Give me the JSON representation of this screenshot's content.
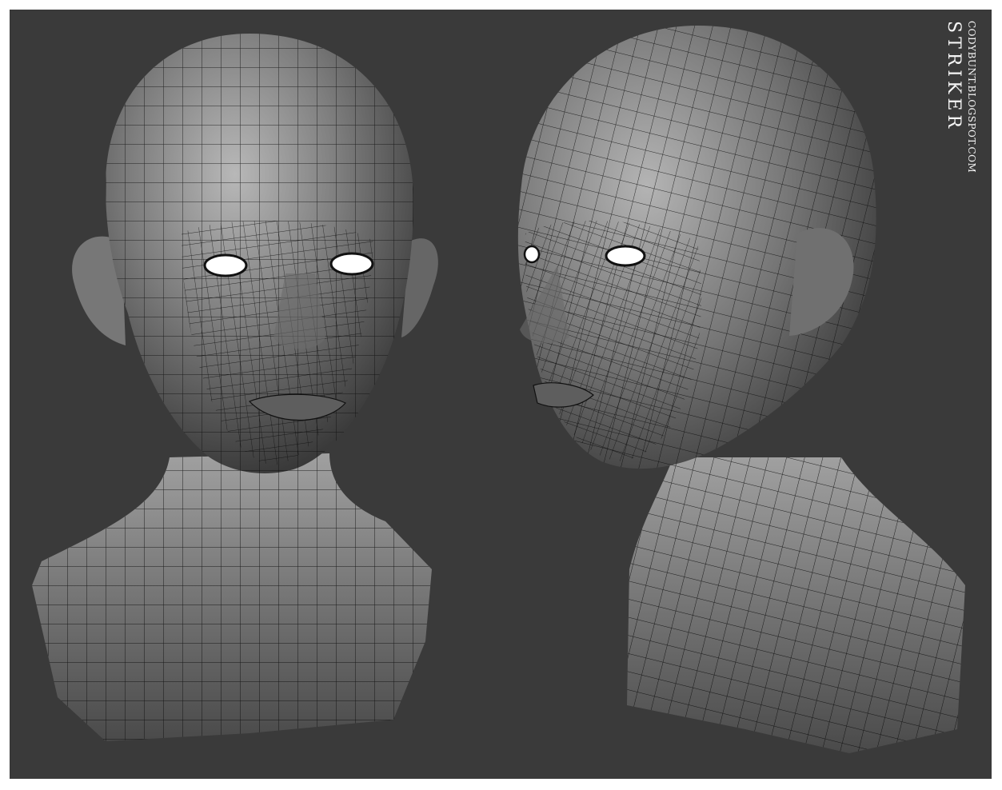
{
  "artwork": {
    "title": "STRIKER",
    "url": "CODYBUNT.BLOGSPOT.COM",
    "views": [
      "front-bust",
      "three-quarter-bust"
    ],
    "colors": {
      "background": "#3a3a3a",
      "border": "#ffffff",
      "skin_light": "#b8b8b8",
      "skin_mid": "#7a7a7a",
      "skin_dark": "#2e2e2e",
      "wire": "#0a0a0a",
      "eye": "#ffffff"
    }
  }
}
